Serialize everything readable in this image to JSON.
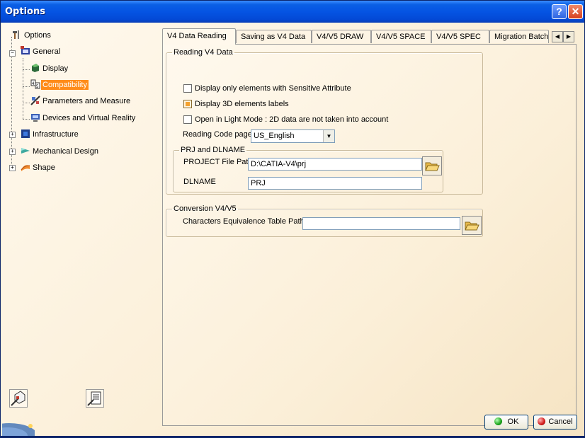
{
  "window": {
    "title": "Options",
    "help_glyph": "?",
    "close_glyph": "✕"
  },
  "tree": {
    "root": "Options",
    "items": [
      {
        "label": "General",
        "icon": "general-icon"
      },
      {
        "label": "Display",
        "icon": "display-icon"
      },
      {
        "label": "Compatibility",
        "icon": "compatibility-icon",
        "selected": true
      },
      {
        "label": "Parameters and Measure",
        "icon": "parameters-icon"
      },
      {
        "label": "Devices and Virtual Reality",
        "icon": "devices-icon"
      },
      {
        "label": "Infrastructure",
        "icon": "infrastructure-icon"
      },
      {
        "label": "Mechanical Design",
        "icon": "mechanical-design-icon"
      },
      {
        "label": "Shape",
        "icon": "shape-icon"
      }
    ]
  },
  "tabs": [
    {
      "label": "V4 Data Reading",
      "active": true
    },
    {
      "label": "Saving as V4 Data"
    },
    {
      "label": "V4/V5 DRAW"
    },
    {
      "label": "V4/V5 SPACE"
    },
    {
      "label": "V4/V5 SPEC"
    },
    {
      "label": "Migration Batch"
    }
  ],
  "reading": {
    "legend": "Reading V4 Data",
    "cb1_label": "Display only elements with Sensitive Attribute",
    "cb2_label": "Display 3D elements labels",
    "cb3_label": "Open in Light Mode : 2D data are not taken into account",
    "code_page_label": "Reading Code page",
    "code_page_value": "US_English"
  },
  "prj": {
    "legend": "PRJ and DLNAME",
    "path_label": "PROJECT File Path",
    "path_value": "D:\\CATIA-V4\\prj",
    "dlname_label": "DLNAME",
    "dlname_value": "PRJ"
  },
  "conversion": {
    "legend": "Conversion V4/V5",
    "table_label": "Characters Equivalence Table Path",
    "table_value": ""
  },
  "buttons": {
    "ok": "OK",
    "cancel": "Cancel"
  },
  "colors": {
    "accent_selected": "#ff8c1a",
    "titlebar": "#0554e3"
  }
}
